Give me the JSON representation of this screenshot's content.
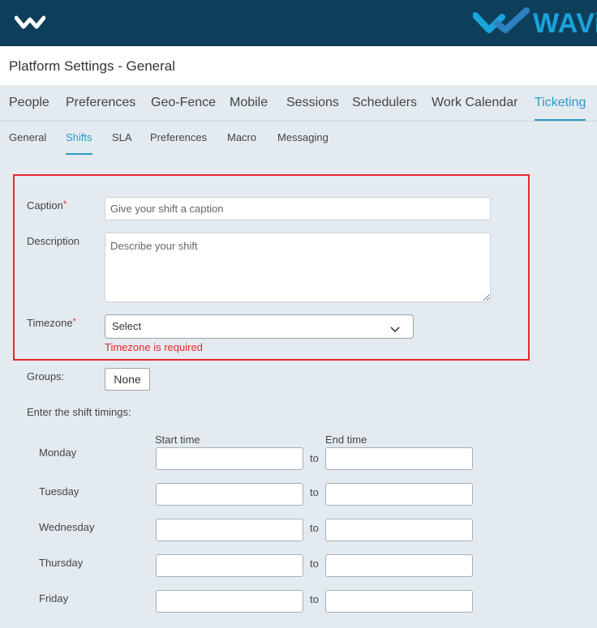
{
  "header": {
    "brand": "WAVi",
    "colors": {
      "bar": "#0e3f5a",
      "brand": "#1aa3dc",
      "accent": "#2a9bc8",
      "error": "#e8272b"
    }
  },
  "page": {
    "title": "Platform Settings - General"
  },
  "tabs": [
    {
      "label": "People"
    },
    {
      "label": "Preferences"
    },
    {
      "label": "Geo-Fence"
    },
    {
      "label": "Mobile"
    },
    {
      "label": "Sessions"
    },
    {
      "label": "Schedulers"
    },
    {
      "label": "Work Calendar"
    },
    {
      "label": "Ticketing",
      "active": true
    }
  ],
  "subtabs": [
    {
      "label": "General"
    },
    {
      "label": "Shifts",
      "active": true
    },
    {
      "label": "SLA"
    },
    {
      "label": "Preferences"
    },
    {
      "label": "Macro"
    },
    {
      "label": "Messaging"
    }
  ],
  "form": {
    "caption": {
      "label": "Caption",
      "required_mark": "*",
      "placeholder": "Give your shift a caption",
      "value": ""
    },
    "description": {
      "label": "Description",
      "placeholder": "Describe your shift",
      "value": ""
    },
    "timezone": {
      "label": "Timezone",
      "required_mark": "*",
      "selected": "Select",
      "error": "Timezone is required"
    },
    "groups": {
      "label": "Groups:",
      "button": "None"
    },
    "timings": {
      "heading": "Enter the shift timings:",
      "start_label": "Start time",
      "end_label": "End time",
      "separator": "to",
      "days": [
        {
          "day": "Monday",
          "start": "",
          "end": ""
        },
        {
          "day": "Tuesday",
          "start": "",
          "end": ""
        },
        {
          "day": "Wednesday",
          "start": "",
          "end": ""
        },
        {
          "day": "Thursday",
          "start": "",
          "end": ""
        },
        {
          "day": "Friday",
          "start": "",
          "end": ""
        }
      ]
    }
  },
  "icons": [
    "wavi-logo-small-icon",
    "wavi-logo-icon",
    "chevron-down-icon"
  ]
}
